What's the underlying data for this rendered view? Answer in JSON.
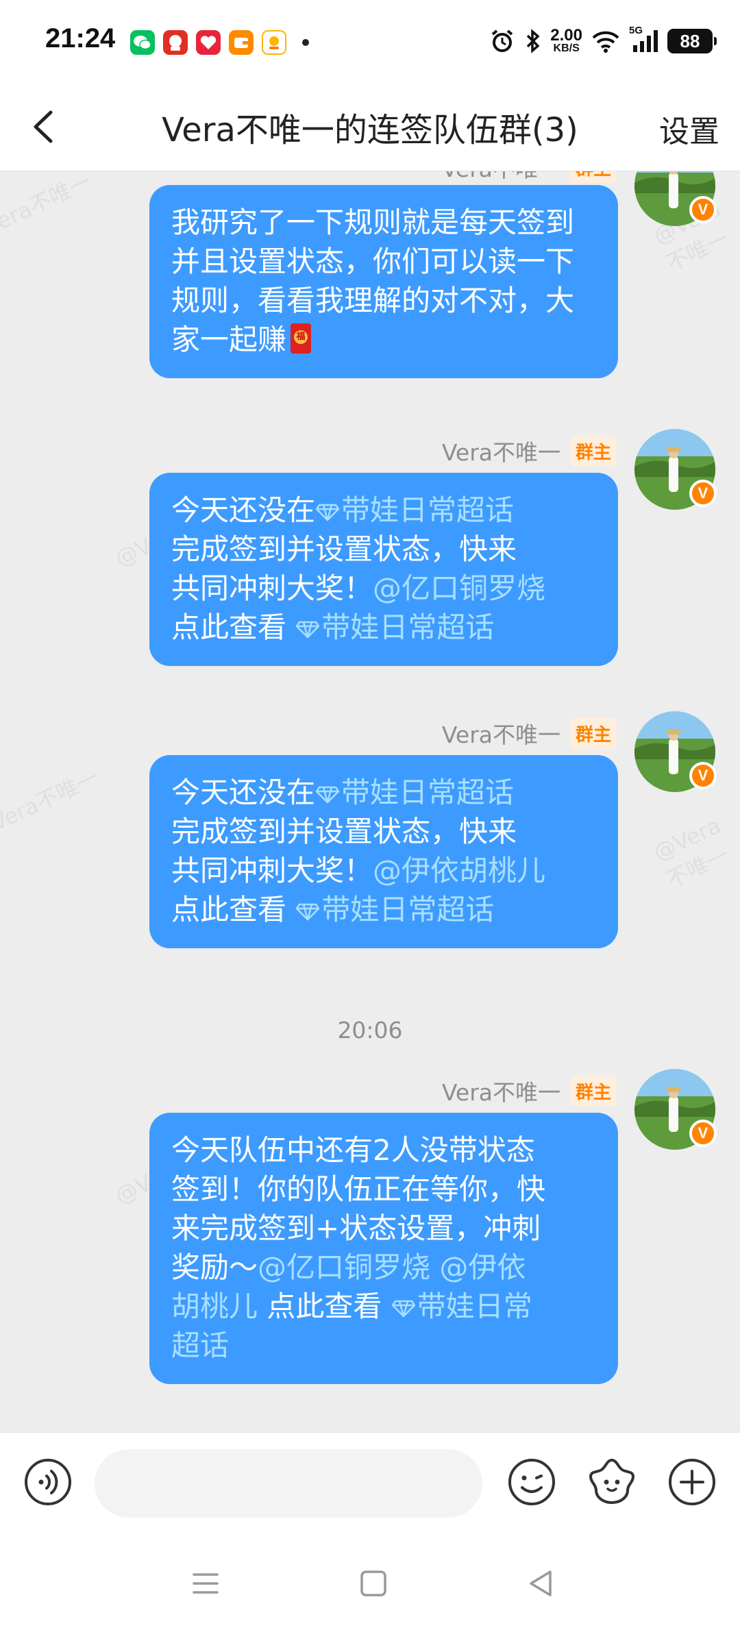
{
  "status_bar": {
    "time": "21:24",
    "net_speed_value": "2.00",
    "net_speed_unit": "KB/S",
    "signal_label": "5G",
    "battery": "88"
  },
  "header": {
    "title": "Vera不唯一的连签队伍群(3)",
    "settings_label": "设置"
  },
  "messages": [
    {
      "sender": "Vera不唯一",
      "role": "群主",
      "text": "我研究了一下规则就是每天签到并且设置状态，你们可以读一下规则，看看我理解的对不对，大家一起赚"
    },
    {
      "sender": "Vera不唯一",
      "role": "群主",
      "line1_prefix": "今天还没在",
      "topic": "带娃日常超话",
      "line2": "完成签到并设置状态，快来",
      "line3_prefix": "共同冲刺大奖！",
      "mention": "@亿口铜罗烧",
      "line4_prefix": "点此查看 ",
      "topic2": "带娃日常超话"
    },
    {
      "sender": "Vera不唯一",
      "role": "群主",
      "line1_prefix": "今天还没在",
      "topic": "带娃日常超话",
      "line2": "完成签到并设置状态，快来",
      "line3_prefix": "共同冲刺大奖！",
      "mention": "@伊依胡桃儿",
      "line4_prefix": "点此查看 ",
      "topic2": "带娃日常超话"
    },
    {
      "sender": "Vera不唯一",
      "role": "群主",
      "line1": "今天队伍中还有2人没带状态",
      "line2": "签到！你的队伍正在等你，快",
      "line3": "来完成签到+状态设置，冲刺",
      "line4_prefix": "奖励～",
      "mention1": "@亿口铜罗烧",
      "mention2a": "@伊依",
      "mention2b": "胡桃儿",
      "line5_mid": " 点此查看 ",
      "topic_a": "带娃日常",
      "topic_b": "超话"
    }
  ],
  "time_separator": "20:06",
  "input_bar": {
    "placeholder": ""
  },
  "watermark_text": "@Vera不唯一",
  "colors": {
    "bubble": "#3d9bff",
    "link": "#a9dfff",
    "badge_text": "#ff8200",
    "background": "#ededed"
  }
}
